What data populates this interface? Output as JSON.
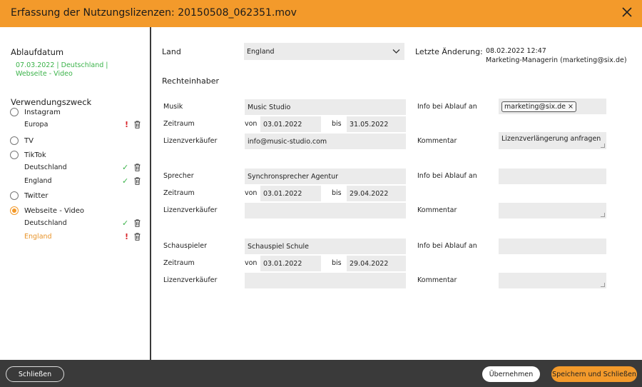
{
  "window": {
    "title": "Erfassung der Nutzungslizenzen: 20150508_062351.mov"
  },
  "sidebar": {
    "expiry_heading": "Ablaufdatum",
    "expiry_line1": "07.03.2022 | Deutschland |",
    "expiry_line2": "Webseite - Video",
    "purpose_heading": "Verwendungszweck",
    "options": [
      {
        "label": "Instagram",
        "selected": false
      },
      {
        "label": "TV",
        "selected": false
      },
      {
        "label": "TikTok",
        "selected": false
      },
      {
        "label": "Twitter",
        "selected": false
      },
      {
        "label": "Webseite - Video",
        "selected": true
      }
    ],
    "subitems": [
      {
        "label": "Europa",
        "status": "!"
      },
      {
        "label": "Deutschland",
        "status": "✓"
      },
      {
        "label": "England",
        "status": "✓"
      },
      {
        "label": "Deutschland",
        "status": "✓"
      },
      {
        "label": "England",
        "status": "!"
      }
    ]
  },
  "main": {
    "land_label": "Land",
    "land_value": "England",
    "changed_label": "Letzte Änderung:",
    "changed_date": "08.02.2022 12:47",
    "changed_by": "Marketing-Managerin (marketing@six.de)",
    "rights_heading": "Rechteinhaber",
    "labels": {
      "period": "Zeitraum",
      "from": "von",
      "to": "bis",
      "seller": "Lizenzverkäufer",
      "info": "Info bei Ablauf an",
      "comment": "Kommentar"
    },
    "groups": [
      {
        "role": "Musik",
        "holder": "Music Studio",
        "from": "03.01.2022",
        "to": "31.05.2022",
        "seller": "info@music-studio.com",
        "info_chip": "marketing@six.de",
        "chip_remove": "×",
        "comment": "Lizenzverlängerung anfragen"
      },
      {
        "role": "Sprecher",
        "holder": "Synchronsprecher Agentur",
        "from": "03.01.2022",
        "to": "29.04.2022",
        "seller": "",
        "comment": ""
      },
      {
        "role": "Schauspieler",
        "holder": "Schauspiel Schule",
        "from": "03.01.2022",
        "to": "29.04.2022",
        "seller": "",
        "comment": ""
      }
    ]
  },
  "footer": {
    "close_label": "Schließen",
    "apply_label": "Übernehmen",
    "save_close_label": "Speichern und Schließen"
  },
  "colors": {
    "accent": "#f39a2b",
    "ok": "#3bb34a",
    "warn": "#d9262c",
    "footer": "#3a3a3a"
  }
}
